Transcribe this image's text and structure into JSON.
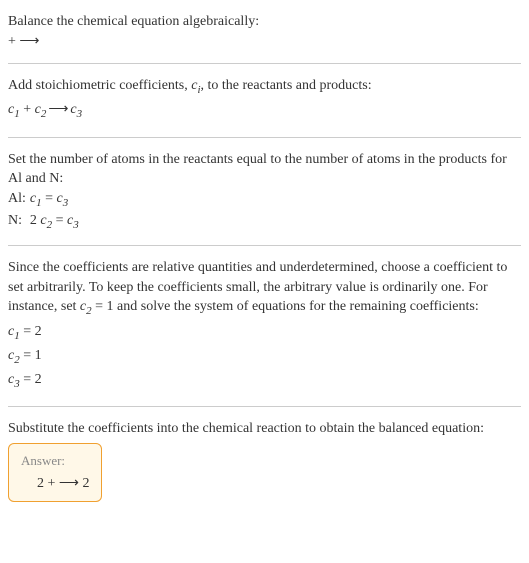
{
  "s1_line1": "Balance the chemical equation algebraically:",
  "s1_line2": " +  ⟶",
  "s2_line1": "Add stoichiometric coefficients, ",
  "s2_ci": "c",
  "s2_ci_sub": "i",
  "s2_line1b": ", to the reactants and products:",
  "s2_eq_c1": "c",
  "s2_eq_c1_sub": "1",
  "s2_eq_plus": " + ",
  "s2_eq_c2": "c",
  "s2_eq_c2_sub": "2",
  "s2_eq_arrow": " ⟶ ",
  "s2_eq_c3": "c",
  "s2_eq_c3_sub": "3",
  "s3_text": "Set the number of atoms in the reactants equal to the number of atoms in the products for Al and N:",
  "s3_al_label": "Al:",
  "s3_al_c1": "c",
  "s3_al_c1_sub": "1",
  "s3_al_eq": " = ",
  "s3_al_c3": "c",
  "s3_al_c3_sub": "3",
  "s3_n_label": "N:",
  "s3_n_two": "2 ",
  "s3_n_c2": "c",
  "s3_n_c2_sub": "2",
  "s3_n_eq": " = ",
  "s3_n_c3": "c",
  "s3_n_c3_sub": "3",
  "s4_text1": "Since the coefficients are relative quantities and underdetermined, choose a coefficient to set arbitrarily. To keep the coefficients small, the arbitrary value is ordinarily one. For instance, set ",
  "s4_c2": "c",
  "s4_c2_sub": "2",
  "s4_text2": " = 1 and solve the system of equations for the remaining coefficients:",
  "s4_eq1_c": "c",
  "s4_eq1_sub": "1",
  "s4_eq1_val": " = 2",
  "s4_eq2_c": "c",
  "s4_eq2_sub": "2",
  "s4_eq2_val": " = 1",
  "s4_eq3_c": "c",
  "s4_eq3_sub": "3",
  "s4_eq3_val": " = 2",
  "s5_text": "Substitute the coefficients into the chemical reaction to obtain the balanced equation:",
  "answer_label": "Answer:",
  "answer_content": "2  +  ⟶ 2"
}
